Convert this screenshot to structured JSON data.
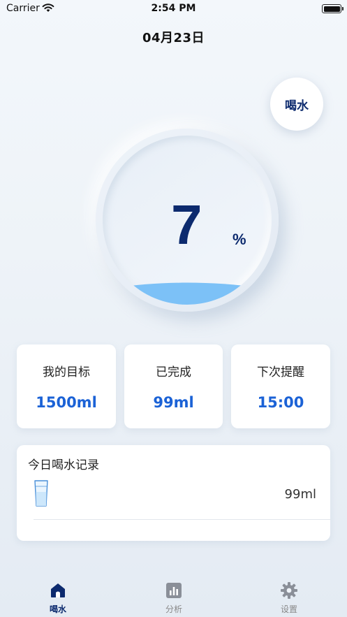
{
  "status_bar": {
    "carrier": "Carrier",
    "time": "2:54 PM"
  },
  "header": {
    "date": "04月23日"
  },
  "drink_button": {
    "label": "喝水"
  },
  "progress": {
    "percent": 7,
    "value_text": "7",
    "unit": "%"
  },
  "stats": [
    {
      "label": "我的目标",
      "value": "1500ml"
    },
    {
      "label": "已完成",
      "value": "99ml"
    },
    {
      "label": "下次提醒",
      "value": "15:00"
    }
  ],
  "records": {
    "title": "今日喝水记录",
    "items": [
      {
        "amount": "99ml",
        "icon": "cup-icon"
      }
    ]
  },
  "tabs": [
    {
      "label": "喝水",
      "icon": "home-icon",
      "active": true
    },
    {
      "label": "分析",
      "icon": "chart-icon",
      "active": false
    },
    {
      "label": "设置",
      "icon": "gear-icon",
      "active": false
    }
  ],
  "colors": {
    "accent": "#1b62d6",
    "primary_dark": "#0c2a6e",
    "water": "#7cc1f7"
  }
}
